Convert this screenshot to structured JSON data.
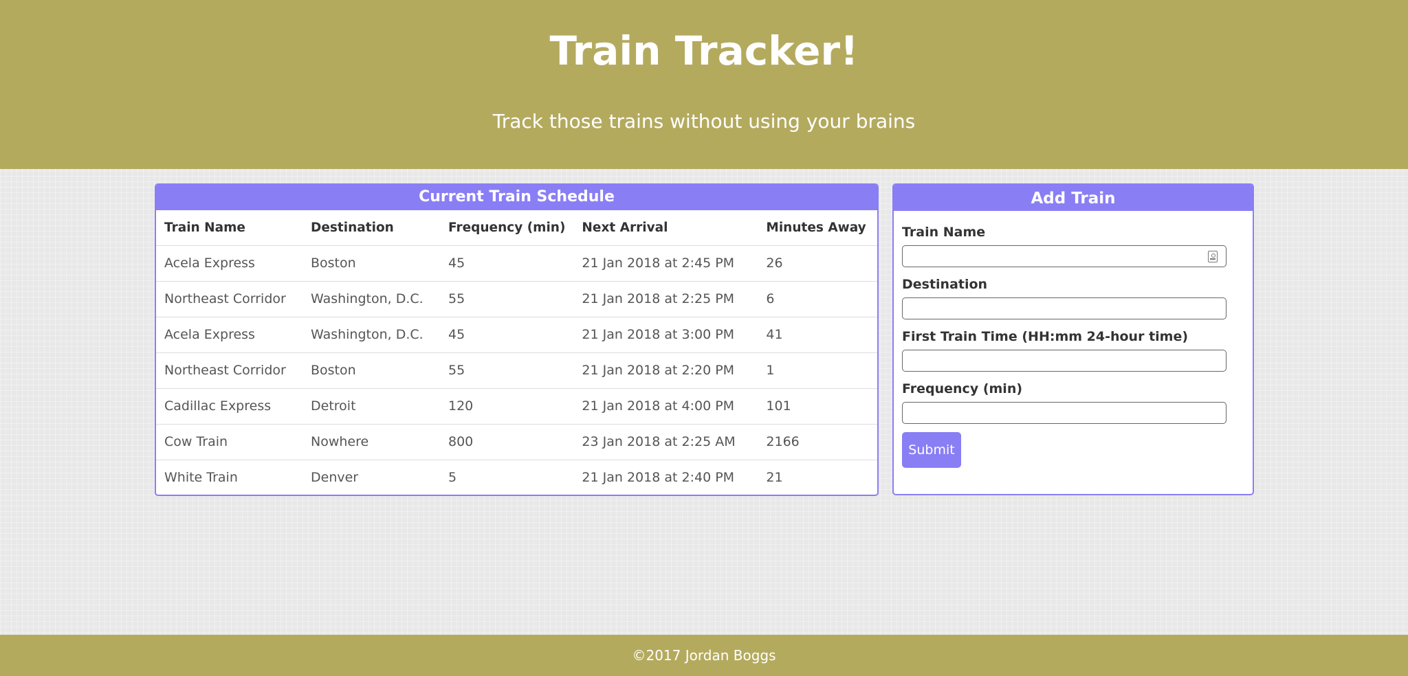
{
  "header": {
    "title": "Train Tracker!",
    "subtitle": "Track those trains without using your brains"
  },
  "schedule": {
    "heading": "Current Train Schedule",
    "columns": [
      "Train Name",
      "Destination",
      "Frequency (min)",
      "Next Arrival",
      "Minutes Away"
    ],
    "rows": [
      [
        "Acela Express",
        "Boston",
        "45",
        "21 Jan 2018 at 2:45 PM",
        "26"
      ],
      [
        "Northeast Corridor",
        "Washington, D.C.",
        "55",
        "21 Jan 2018 at 2:25 PM",
        "6"
      ],
      [
        "Acela Express",
        "Washington, D.C.",
        "45",
        "21 Jan 2018 at 3:00 PM",
        "41"
      ],
      [
        "Northeast Corridor",
        "Boston",
        "55",
        "21 Jan 2018 at 2:20 PM",
        "1"
      ],
      [
        "Cadillac Express",
        "Detroit",
        "120",
        "21 Jan 2018 at 4:00 PM",
        "101"
      ],
      [
        "Cow Train",
        "Nowhere",
        "800",
        "23 Jan 2018 at 2:25 AM",
        "2166"
      ],
      [
        "White Train",
        "Denver",
        "5",
        "21 Jan 2018 at 2:40 PM",
        "21"
      ]
    ]
  },
  "add_train": {
    "heading": "Add Train",
    "fields": [
      {
        "label": "Train Name",
        "value": "",
        "placeholder": ""
      },
      {
        "label": "Destination",
        "value": "",
        "placeholder": ""
      },
      {
        "label": "First Train Time (HH:mm 24-hour time)",
        "value": "",
        "placeholder": ""
      },
      {
        "label": "Frequency (min)",
        "value": "",
        "placeholder": ""
      }
    ],
    "submit_label": "Submit"
  },
  "footer": {
    "text": "©2017 Jordan Boggs"
  },
  "colors": {
    "header_bg": "#b4aa5e",
    "accent": "#8a7ef5",
    "page_bg": "#e8e8e8"
  },
  "icons": {
    "train_name_field_icon": "contact-card-icon"
  }
}
